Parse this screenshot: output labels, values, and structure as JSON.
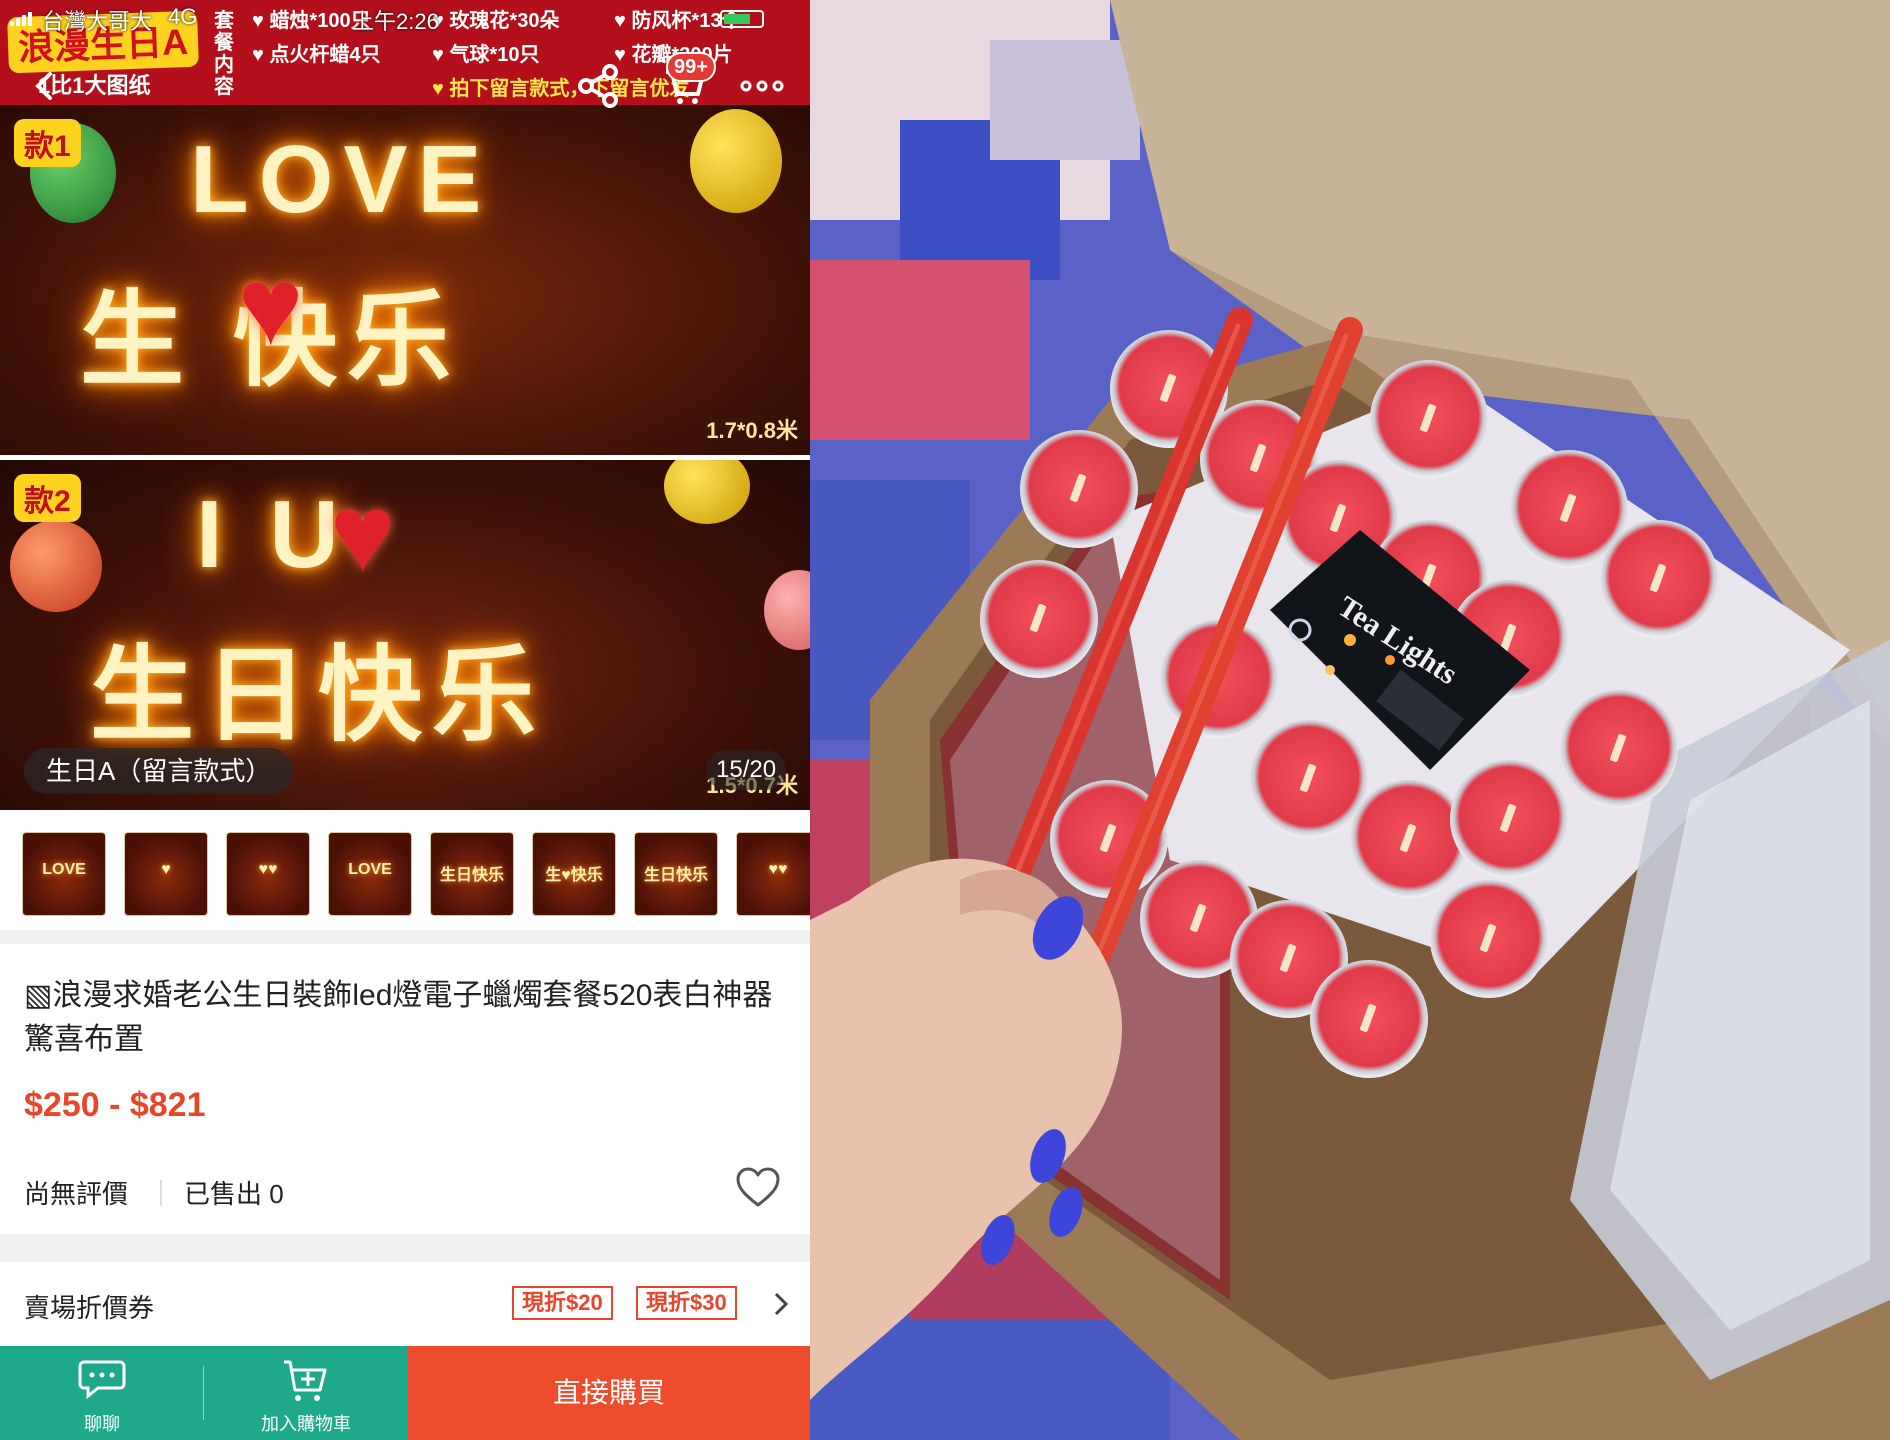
{
  "status_bar": {
    "carrier": "台灣大哥大",
    "network": "4G",
    "time": "上午2:26"
  },
  "banner": {
    "title": "浪漫生日A",
    "subtitle": "1比1大图纸",
    "package_vertical": "套餐内容",
    "items": [
      "蜡烛*100只",
      "点火杆蜡4只",
      "玫瑰花*30朵",
      "气球*10只",
      "防风杯*13个",
      "花瓣*300片"
    ],
    "note": "拍下留言款式，下留言优发"
  },
  "nav": {
    "back_icon": "arrow-left-icon",
    "share_icon": "share-icon",
    "cart_icon": "cart-icon",
    "more_icon": "more-dots-icon",
    "cart_badge": "99+"
  },
  "gallery": {
    "style1_tag": "款1",
    "style1_text_top": "LOVE",
    "style1_text_bottom": "生 快乐",
    "style1_size": "1.7*0.8米",
    "style2_tag": "款2",
    "style2_text_top": "I    U",
    "style2_text_bottom": "生日快乐",
    "style2_size": "1.5*0.7米",
    "variant_label": "生日A（留言款式）",
    "page_counter": "15/20"
  },
  "thumbnails": [
    "LOVE",
    "♥",
    "♥♥",
    "LOVE",
    "生日快乐",
    "生♥快乐",
    "生日快乐",
    "♥♥"
  ],
  "product": {
    "title": "▧浪漫求婚老公生日裝飾led燈電子蠟燭套餐520表白神器驚喜布置",
    "price": "$250 - $821",
    "rating_text": "尚無評價",
    "sold_text": "已售出 0",
    "favorite_icon": "heart-outline-icon"
  },
  "coupons": {
    "label": "賣場折價券",
    "items": [
      "現折$20",
      "現折$30"
    ],
    "arrow_icon": "chevron-right-icon"
  },
  "bottom_bar": {
    "chat_label": "聊聊",
    "chat_icon": "chat-bubble-icon",
    "cart_label": "加入購物車",
    "cart_icon": "cart-plus-icon",
    "buy_label": "直接購買"
  },
  "photo": {
    "card_text": "Tea Lights"
  },
  "colors": {
    "accent_orange": "#ee4d2d",
    "teal": "#1ea88c",
    "price_red": "#e8452b"
  }
}
